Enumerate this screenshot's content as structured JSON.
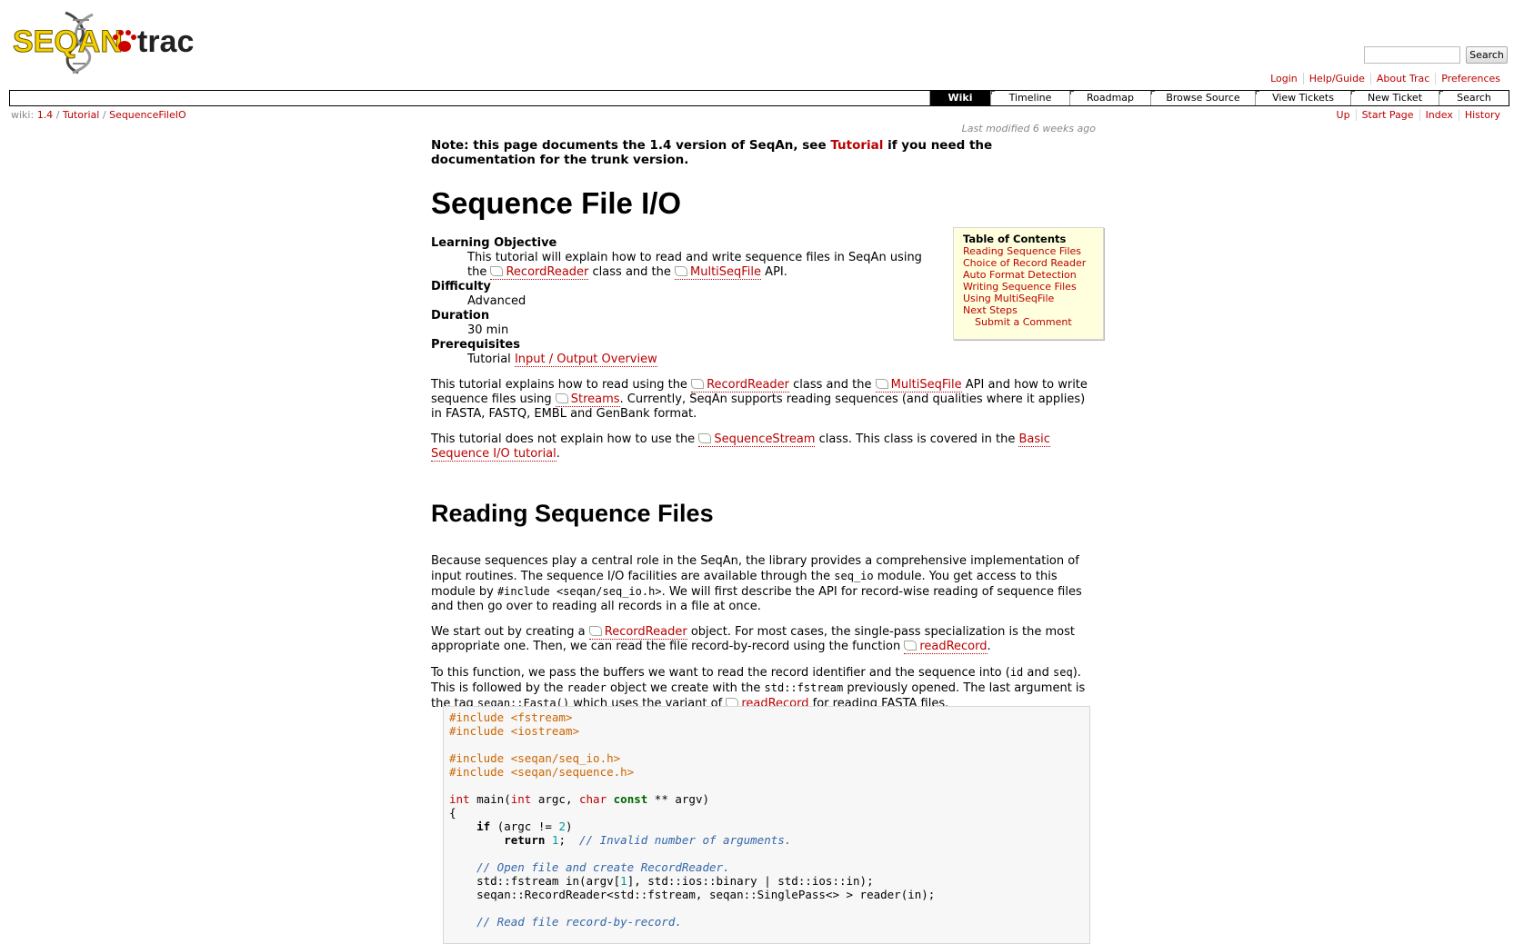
{
  "header": {
    "logo_text_seqan": "SEQAN",
    "logo_text_trac": "trac",
    "search_button": "Search",
    "search_placeholder": ""
  },
  "metanav": [
    "Login",
    "Help/Guide",
    "About Trac",
    "Preferences"
  ],
  "mainnav": [
    "Wiki",
    "Timeline",
    "Roadmap",
    "Browse Source",
    "View Tickets",
    "New Ticket",
    "Search"
  ],
  "breadcrumb": {
    "prefix": "wiki:",
    "parts": [
      "1.4",
      "Tutorial",
      "SequenceFileIO"
    ],
    "sep": "/"
  },
  "ctxtnav": [
    "Up",
    "Start Page",
    "Index",
    "History"
  ],
  "last_modified": "Last modified 6 weeks ago",
  "note": {
    "pre": "Note: this page documents the 1.4 version of SeqAn, see ",
    "link": "Tutorial",
    "post": " if you need the documentation for the trunk version."
  },
  "title": "Sequence File I/O",
  "meta": [
    {
      "term": "Learning Objective",
      "desc_pre": "This tutorial will explain how to read and write sequence files in SeqAn using the ",
      "link1": "RecordReader",
      "mid": " class and the ",
      "link2": "MultiSeqFile",
      "post": " API."
    },
    {
      "term": "Difficulty",
      "desc": "Advanced"
    },
    {
      "term": "Duration",
      "desc": "30 min"
    },
    {
      "term": "Prerequisites",
      "desc_pre": "Tutorial ",
      "link": "Input / Output Overview"
    }
  ],
  "toc": {
    "title": "Table of Contents",
    "entries": [
      "Reading Sequence Files",
      "Choice of Record Reader",
      "Auto Format Detection",
      "Writing Sequence Files",
      "Using MultiSeqFile",
      "Next Steps"
    ],
    "sub_entry": "Submit a Comment"
  },
  "intro1": {
    "a": "This tutorial explains how to read using the ",
    "l1": "RecordReader",
    "b": " class and the ",
    "l2": "MultiSeqFile",
    "c": " API and how to write sequence files using ",
    "l3": "Streams",
    "d": ". Currently, SeqAn supports reading sequences (and qualities where it applies) in FASTA, FASTQ, EMBL and GenBank format."
  },
  "intro2": {
    "a": "This tutorial does not explain how to use the ",
    "l1": "SequenceStream",
    "b": " class. This class is covered in the ",
    "l2": "Basic Sequence I/O tutorial",
    "c": "."
  },
  "section1_title": "Reading Sequence Files",
  "para1": {
    "a": "Because sequences play a central role in the SeqAn, the library provides a comprehensive implementation of input routines. The sequence I/O facilities are available through the ",
    "c1": "seq_io",
    "b": " module. You get access to this module by ",
    "c2": "#include <seqan/seq_io.h>",
    "c": ". We will first describe the API for record-wise reading of sequence files and then go over to reading all records in a file at once."
  },
  "para2": {
    "a": "We start out by creating a ",
    "l1": "RecordReader",
    "b": " object. For most cases, the single-pass specialization is the most appropriate one. Then, we can read the file record-by-record using the function ",
    "l2": "readRecord",
    "c": "."
  },
  "para3": {
    "a": "To this function, we pass the buffers we want to read the record identifier and the sequence into (",
    "c1": "id",
    "b": " and ",
    "c2": "seq",
    "c": "). This is followed by the ",
    "c3": "reader",
    "d": " object we create with the ",
    "c4": "std::fstream",
    "e": " previously opened. The last argument is the tag ",
    "c5": "seqan::Fasta()",
    "f": " which uses the variant of ",
    "l1": "readRecord",
    "g": " for reading FASTA files."
  },
  "code": {
    "l1": "#include <fstream>",
    "l2": "#include <iostream>",
    "l3": "#include <seqan/seq_io.h>",
    "l4": "#include <seqan/sequence.h>",
    "int": "int",
    "main": " main(",
    "argc": " argc, ",
    "char": "char",
    "const": "const",
    "argv": " ** argv)",
    "brace": "{",
    "if": "if",
    "ifcond": " (argc != ",
    "two": "2",
    "ifclose": ")",
    "return": "return",
    "one": "1",
    "semi": ";  ",
    "comment1": "// Invalid number of arguments.",
    "comment2": "// Open file and create RecordReader.",
    "stream": "std::fstream in(argv[",
    "streamidx": "1",
    "streamrest": "], std::ios::binary | std::ios::in);",
    "reader": "seqan::RecordReader<std::fstream, seqan::SinglePass<> > reader(in);",
    "comment3": "// Read file record-by-record."
  }
}
